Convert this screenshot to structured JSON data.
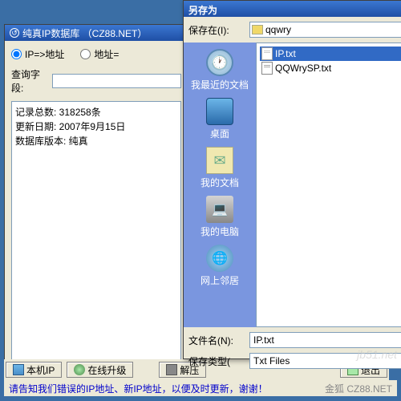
{
  "mainWindow": {
    "title": "纯真IP数据库 （CZ88.NET）",
    "radio1": "IP=>地址",
    "radio2": "地址=",
    "queryLabel": "查询字段:",
    "info": {
      "recordCount": "记录总数: 318258条",
      "updateDate": "更新日期: 2007年9月15日",
      "dbVersion": "数据库版本: 纯真"
    }
  },
  "buttons": {
    "localIP": "本机IP",
    "onlineUpgrade": "在线升级",
    "decompress": "解压",
    "exit": "退出"
  },
  "status": {
    "message": "请告知我们错误的IP地址、新IP地址，以便及时更新，谢谢！",
    "brand": "金狐 CZ88.NET"
  },
  "saveDialog": {
    "title": "另存为",
    "saveInLabel": "保存在(I):",
    "saveInValue": "qqwry",
    "places": {
      "recent": "我最近的文档",
      "desktop": "桌面",
      "mydocs": "我的文档",
      "mycomp": "我的电脑",
      "network": "网上邻居"
    },
    "files": {
      "file1": "IP.txt",
      "file2": "QQWrySP.txt"
    },
    "filenameLabel": "文件名(N):",
    "filenameValue": "IP.txt",
    "filetypeLabel": "保存类型(",
    "filetypeValue": "Txt Files"
  },
  "partialMenu": {
    "m1": "",
    "m2": "",
    "m3": ""
  },
  "watermark": "jb51.net"
}
